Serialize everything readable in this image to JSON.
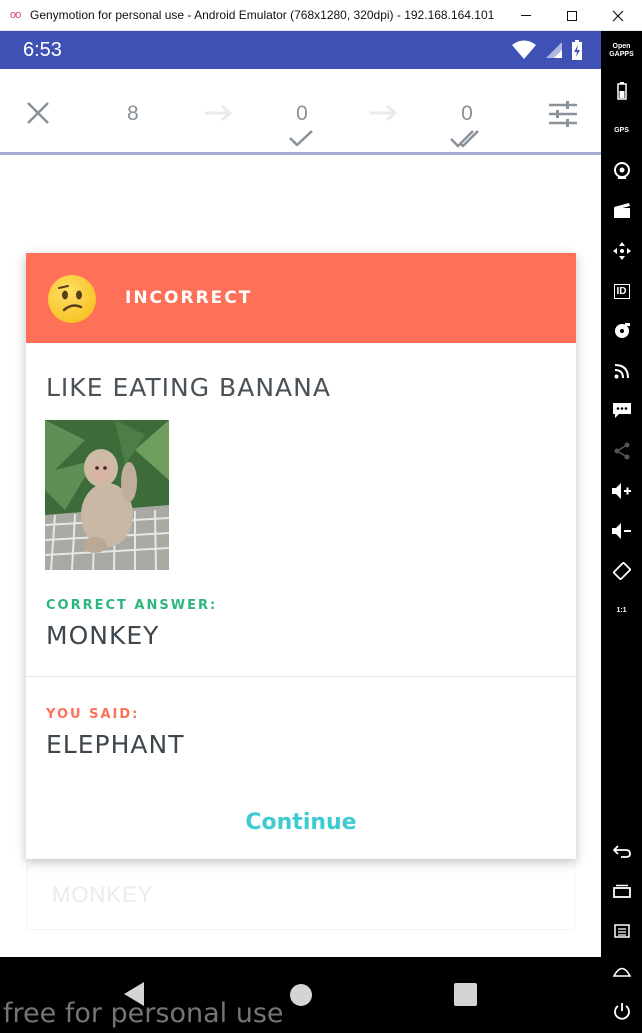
{
  "window": {
    "logo": "oo",
    "title": "Genymotion for personal use - Android Emulator (768x1280, 320dpi) - 192.168.164.101"
  },
  "status_bar": {
    "time": "6:53"
  },
  "toolbar": {
    "new_count": "8",
    "learned_count": "0",
    "mastered_count": "0"
  },
  "dialog": {
    "header_title": "INCORRECT",
    "question": "LIKE EATING BANANA",
    "correct_label": "CORRECT ANSWER:",
    "correct_answer": "MONKEY",
    "you_said_label": "YOU SAID:",
    "user_answer": "ELEPHANT",
    "continue_label": "Continue"
  },
  "background_card": {
    "text": "MONKEY"
  },
  "side_tools": {
    "open_gapps": "Open GAPPS",
    "gps": "GPS",
    "id": "ID",
    "aspect": "1:1"
  },
  "watermark": "free for personal use",
  "colors": {
    "status_bar": "#3f51b5",
    "header_incorrect": "#fe7058",
    "correct_green": "#2cb67d",
    "continue_teal": "#3ccbd1"
  }
}
